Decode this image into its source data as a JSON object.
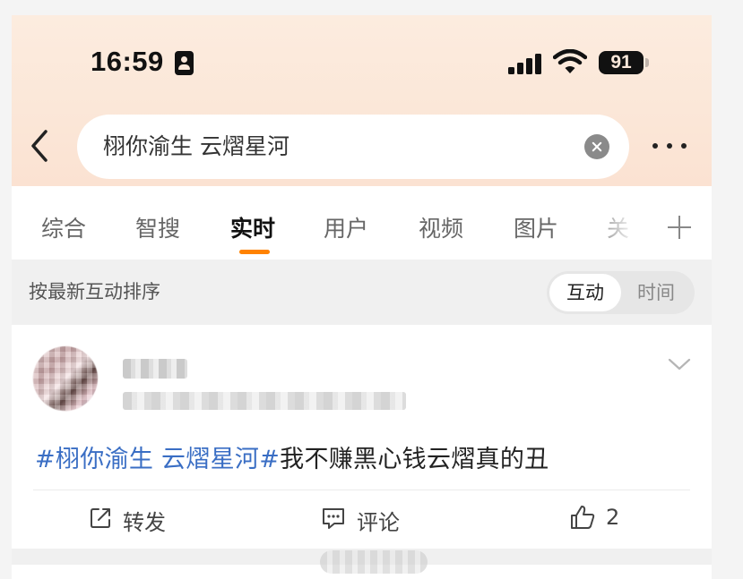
{
  "status_bar": {
    "time": "16:59",
    "battery_percent": "91",
    "signal_bars": 4,
    "icons": [
      "contact-card-icon",
      "signal-icon",
      "wifi-icon",
      "battery-icon"
    ]
  },
  "search": {
    "query": "栩你渝生 云熠星河",
    "back_icon": "chevron-left-icon",
    "clear_icon": "clear-icon",
    "more_icon": "more-dots-icon"
  },
  "tabs": [
    {
      "label": "综合",
      "active": false
    },
    {
      "label": "智搜",
      "active": false
    },
    {
      "label": "实时",
      "active": true
    },
    {
      "label": "用户",
      "active": false
    },
    {
      "label": "视频",
      "active": false
    },
    {
      "label": "图片",
      "active": false
    },
    {
      "label": "关",
      "active": false
    }
  ],
  "tab_add_icon": "plus-icon",
  "colors": {
    "accent": "#ff8200",
    "hashtag": "#3a6ec4",
    "header_gradient": "#fbe7d8"
  },
  "sort": {
    "label": "按最新互动排序",
    "options": [
      "互动",
      "时间"
    ],
    "selected": "互动"
  },
  "post": {
    "hashtag": "#栩你渝生 云熠星河#",
    "text": "我不赚黑心钱云熠真的丑",
    "actions": {
      "repost": "转发",
      "comment": "评论",
      "like_count": "2"
    }
  }
}
